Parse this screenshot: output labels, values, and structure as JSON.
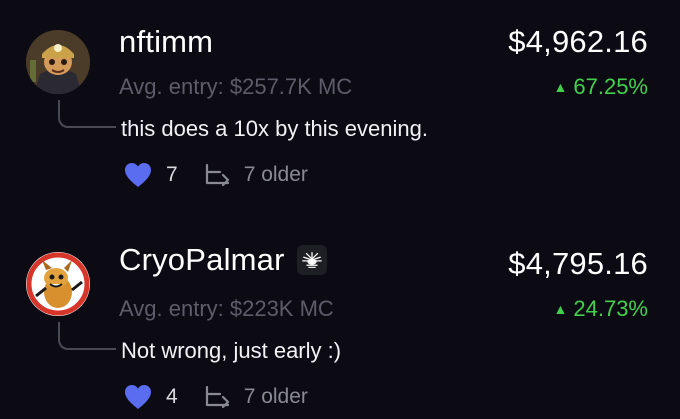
{
  "posts": [
    {
      "username": "nftimm",
      "avg_entry": "Avg. entry: $257.7K MC",
      "amount": "$4,962.16",
      "change": "67.25%",
      "comment": "this does a 10x by this evening.",
      "likes": "7",
      "older": "7 older",
      "avatar_icon": "miner-character-avatar",
      "has_badge": false
    },
    {
      "username": "CryoPalmar",
      "avg_entry": "Avg. entry: $223K MC",
      "amount": "$4,795.16",
      "change": "24.73%",
      "comment": "Not wrong, just early :)",
      "likes": "4",
      "older": "7 older",
      "avatar_icon": "dog-character-avatar",
      "has_badge": true,
      "badge_icon": "sunburst-badge-icon"
    }
  ],
  "colors": {
    "background": "#0c0b14",
    "positive": "#43d14d",
    "heart": "#5a6cf0",
    "muted": "#5d5c68"
  }
}
